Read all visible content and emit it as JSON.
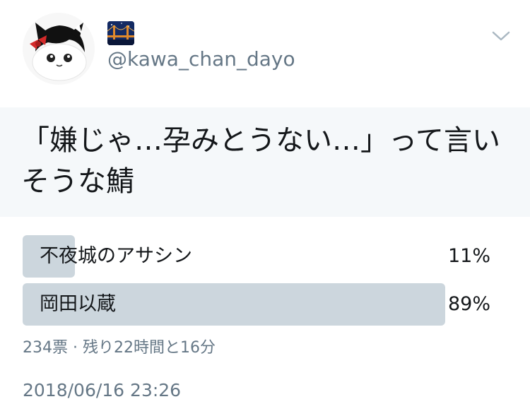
{
  "user": {
    "avatar": "avatar-chibi-character",
    "name_icon": "night-bridge-emoji",
    "handle": "@kawa_chan_dayo"
  },
  "menu": {
    "icon": "chevron-down-icon"
  },
  "tweet": {
    "text": "「嫌じゃ…孕みとうない…」って言いそうな鯖"
  },
  "poll": {
    "options": [
      {
        "label": "不夜城のアサシン",
        "percent_text": "11%",
        "percent": 11
      },
      {
        "label": "岡田以蔵",
        "percent_text": "89%",
        "percent": 89
      }
    ],
    "meta": "234票 · 残り22時間と16分"
  },
  "timestamp": "2018/06/16 23:26",
  "colors": {
    "bar": "#ccd6dd",
    "muted_text": "#657786",
    "band": "#f5f8fa"
  }
}
